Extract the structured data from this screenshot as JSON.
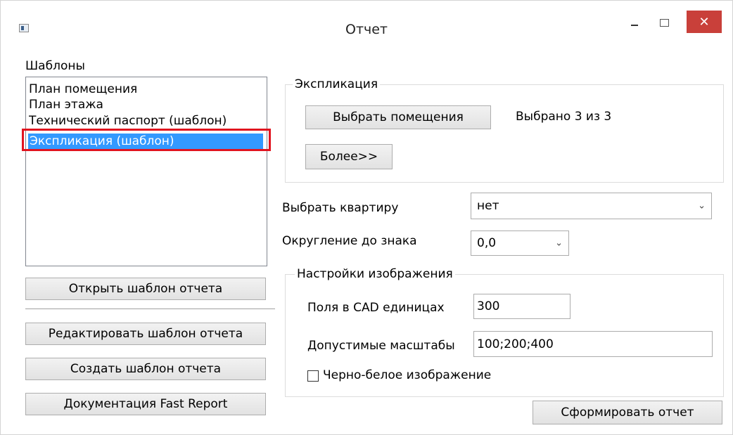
{
  "window": {
    "title": "Отчет",
    "minimize_glyph": "",
    "maximize_glyph": "",
    "close_glyph": "✕"
  },
  "templates": {
    "label": "Шаблоны",
    "items": [
      {
        "label": "План помещения"
      },
      {
        "label": "План этажа"
      },
      {
        "label": "Технический паспорт (шаблон)"
      },
      {
        "label": "Экспликация (шаблон)"
      }
    ],
    "selected_index": 3
  },
  "left_buttons": {
    "open": "Открыть шаблон отчета",
    "edit": "Редактировать шаблон отчета",
    "create": "Создать шаблон отчета",
    "docs": "Документация Fast Report"
  },
  "explication": {
    "group_title": "Экспликация",
    "select_rooms_button": "Выбрать помещения",
    "selected_status": "Выбрано 3 из 3",
    "more_button": "Более>>"
  },
  "apartment": {
    "label": "Выбрать квартиру",
    "value": "нет"
  },
  "rounding": {
    "label": "Округление до знака",
    "value": "0,0"
  },
  "image_settings": {
    "group_title": "Настройки изображения",
    "margins_label": "Поля в CAD единицах",
    "margins_value": "300",
    "scales_label": "Допустимые масштабы",
    "scales_value": "100;200;400",
    "bw_label": "Черно-белое изображение",
    "bw_checked": false
  },
  "generate_button": "Сформировать отчет",
  "colors": {
    "selection": "#3399ff",
    "highlight_border": "#e1141f",
    "close_button": "#c9403a"
  }
}
